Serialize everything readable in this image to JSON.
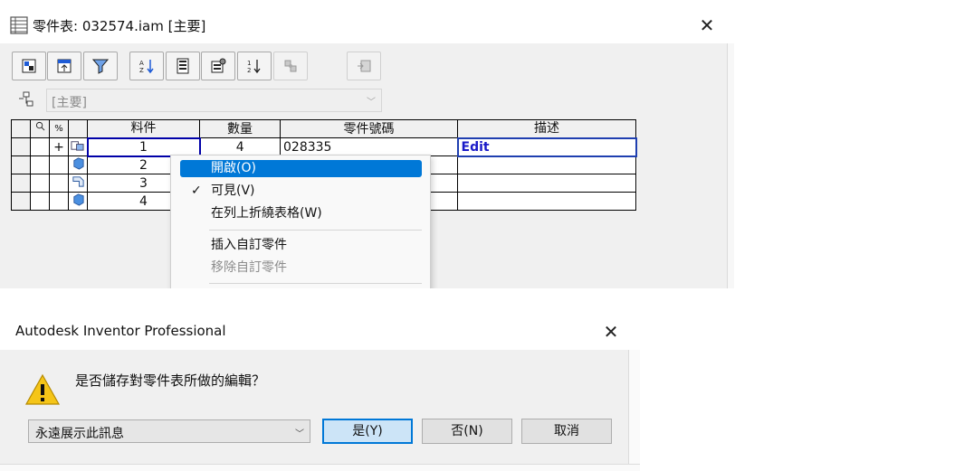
{
  "bom_window": {
    "title": "零件表: 032574.iam [主要]",
    "close_glyph": "✕",
    "toolbar": {
      "buttons": [
        {
          "name": "view-options-icon"
        },
        {
          "name": "expand-icon"
        },
        {
          "name": "filter-icon"
        },
        {
          "name": "sort-icon"
        },
        {
          "name": "item-numbering-icon"
        },
        {
          "name": "properties-icon"
        },
        {
          "name": "renumber-icon"
        },
        {
          "name": "merge-icon",
          "disabled": true
        },
        {
          "name": "export-icon",
          "disabled": true
        }
      ]
    },
    "view_combo": {
      "value": "[主要]",
      "arrow": "﹀"
    },
    "grid": {
      "header_icons": {
        "find": "⊘",
        "percent": "%"
      },
      "columns": [
        "料件",
        "數量",
        "零件號碼",
        "描述"
      ],
      "rows": [
        {
          "expander": "+",
          "item": "1",
          "qty": "4",
          "part": "028335",
          "desc": "Edit"
        },
        {
          "expander": "",
          "item": "2",
          "qty": "",
          "part": "",
          "desc": ""
        },
        {
          "expander": "",
          "item": "3",
          "qty": "",
          "part": "",
          "desc": ""
        },
        {
          "expander": "",
          "item": "4",
          "qty": "",
          "part": "",
          "desc": ""
        }
      ]
    },
    "context_menu": {
      "items": [
        {
          "label": "開啟(O)",
          "highlighted": true,
          "checked": false,
          "disabled": false
        },
        {
          "label": "可見(V)",
          "highlighted": false,
          "checked": true,
          "disabled": false
        },
        {
          "label": "在列上折繞表格(W)",
          "highlighted": false,
          "checked": false,
          "disabled": false
        },
        {
          "label": "插入自訂零件",
          "highlighted": false,
          "checked": false,
          "disabled": false
        },
        {
          "label": "移除自訂零件",
          "highlighted": false,
          "checked": false,
          "disabled": true
        }
      ],
      "check_glyph": "✓"
    }
  },
  "dialog": {
    "title": "Autodesk Inventor Professional",
    "close_glyph": "✕",
    "message": "是否儲存對零件表所做的編輯？",
    "combo": {
      "value": "永遠展示此訊息",
      "arrow": "﹀"
    },
    "buttons": {
      "yes": "是(Y)",
      "no": "否(N)",
      "cancel": "取消"
    }
  },
  "colors": {
    "highlight": "#0078d7",
    "edit_text": "#1a1ac8",
    "primary_button": "#cce4f7"
  }
}
